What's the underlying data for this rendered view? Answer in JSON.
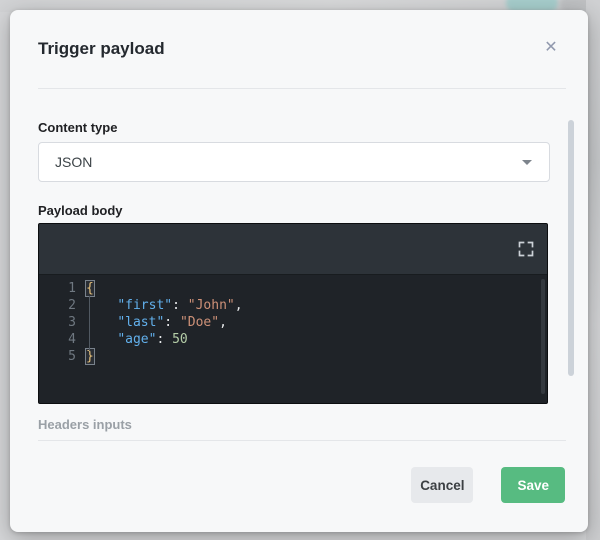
{
  "modal": {
    "title": "Trigger payload",
    "close_glyph": "✕"
  },
  "form": {
    "content_type": {
      "label": "Content type",
      "value": "JSON"
    },
    "payload_body": {
      "label": "Payload body",
      "code": {
        "language": "json",
        "lines": [
          {
            "num": "1",
            "segments": [
              {
                "t": "{",
                "c": "brace",
                "box": true
              }
            ]
          },
          {
            "num": "2",
            "segments": [
              {
                "t": "    ",
                "c": "plain"
              },
              {
                "t": "\"first\"",
                "c": "key"
              },
              {
                "t": ": ",
                "c": "plain"
              },
              {
                "t": "\"John\"",
                "c": "str"
              },
              {
                "t": ",",
                "c": "plain"
              }
            ]
          },
          {
            "num": "3",
            "segments": [
              {
                "t": "    ",
                "c": "plain"
              },
              {
                "t": "\"last\"",
                "c": "key"
              },
              {
                "t": ": ",
                "c": "plain"
              },
              {
                "t": "\"Doe\"",
                "c": "str"
              },
              {
                "t": ",",
                "c": "plain"
              }
            ]
          },
          {
            "num": "4",
            "segments": [
              {
                "t": "    ",
                "c": "plain"
              },
              {
                "t": "\"age\"",
                "c": "key"
              },
              {
                "t": ": ",
                "c": "plain"
              },
              {
                "t": "50",
                "c": "num"
              }
            ]
          },
          {
            "num": "5",
            "segments": [
              {
                "t": "}",
                "c": "brace",
                "box": true
              }
            ]
          }
        ]
      }
    },
    "headers_section_label": "Headers inputs"
  },
  "footer": {
    "cancel_label": "Cancel",
    "save_label": "Save"
  },
  "colors": {
    "accent_green": "#57bb81",
    "editor_toolbar": "#2d3339",
    "editor_bg": "#1f2328",
    "token_key": "#62b0ec",
    "token_string": "#ce9178",
    "token_number": "#b5cea8",
    "token_brace": "#e5c07b"
  }
}
